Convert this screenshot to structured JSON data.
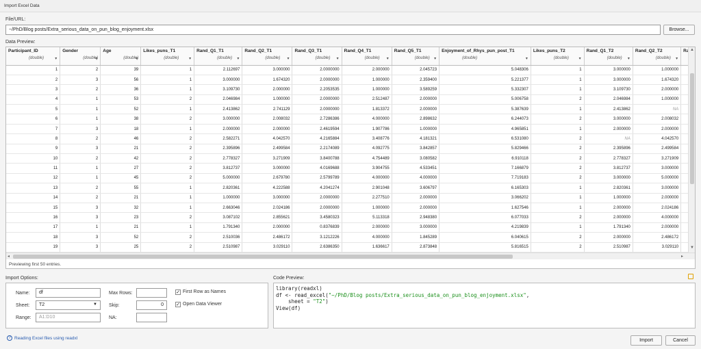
{
  "window": {
    "title": "Import Excel Data"
  },
  "file": {
    "label": "File/URL:",
    "value": "~/PhD/Blog posts/Extra_serious_data_on_pun_blog_enjoyment.xlsx",
    "browse_label": "Browse..."
  },
  "preview": {
    "label": "Data Preview:",
    "footer": "Previewing first 50 entries.",
    "columns": [
      {
        "name": "Participant_ID",
        "type": "(double)"
      },
      {
        "name": "Gender",
        "type": "(double)"
      },
      {
        "name": "Age",
        "type": "(double)"
      },
      {
        "name": "Likes_puns_T1",
        "type": "(double)"
      },
      {
        "name": "Rand_Q1_T1",
        "type": "(double)"
      },
      {
        "name": "Rand_Q2_T1",
        "type": "(double)"
      },
      {
        "name": "Rand_Q3_T1",
        "type": "(double)"
      },
      {
        "name": "Rand_Q4_T1",
        "type": "(double)"
      },
      {
        "name": "Rand_Q5_T1",
        "type": "(double)"
      },
      {
        "name": "Enjoyment_of_Rhys_pun_post_T1",
        "type": "(double)"
      },
      {
        "name": "Likes_puns_T2",
        "type": "(double)"
      },
      {
        "name": "Rand_Q1_T2",
        "type": "(double)"
      },
      {
        "name": "Rand_Q2_T2",
        "type": "(double)"
      },
      {
        "name": "Ra",
        "type": ""
      }
    ],
    "rows": [
      [
        "1",
        "2",
        "39",
        "1",
        "2.112697",
        "3.000000",
        "2.0000000",
        "2.000000",
        "2.045723",
        "5.048306",
        "1",
        "3.000000",
        "1.000000"
      ],
      [
        "2",
        "3",
        "56",
        "1",
        "3.000000",
        "1.674320",
        "2.0000000",
        "1.000000",
        "2.359400",
        "5.221377",
        "1",
        "3.000000",
        "1.674320"
      ],
      [
        "3",
        "2",
        "36",
        "1",
        "3.109730",
        "2.000000",
        "2.2053535",
        "1.000000",
        "3.589259",
        "5.332307",
        "1",
        "3.109730",
        "2.000000"
      ],
      [
        "4",
        "1",
        "53",
        "2",
        "2.046984",
        "1.000000",
        "2.0000000",
        "2.512487",
        "2.000000",
        "5.006758",
        "2",
        "2.046984",
        "1.000000"
      ],
      [
        "5",
        "1",
        "52",
        "1",
        "2.413862",
        "2.741129",
        "2.0000000",
        "1.813372",
        "2.000000",
        "5.387639",
        "1",
        "2.413862",
        "NA"
      ],
      [
        "6",
        "1",
        "38",
        "2",
        "3.000000",
        "2.008032",
        "2.7286386",
        "4.000000",
        "2.898632",
        "6.244073",
        "2",
        "3.000000",
        "2.008032"
      ],
      [
        "7",
        "3",
        "18",
        "1",
        "2.000000",
        "2.000000",
        "2.4619594",
        "1.907786",
        "1.000000",
        "4.965851",
        "1",
        "2.000000",
        "2.000000"
      ],
      [
        "8",
        "2",
        "46",
        "2",
        "2.582271",
        "4.042570",
        "4.2165884",
        "3.408776",
        "4.181321",
        "6.531080",
        "2",
        "NA",
        "4.042570"
      ],
      [
        "9",
        "3",
        "21",
        "2",
        "2.395896",
        "2.499584",
        "2.2174089",
        "4.092775",
        "3.842857",
        "5.829466",
        "2",
        "2.395896",
        "2.499584"
      ],
      [
        "10",
        "2",
        "42",
        "2",
        "2.778327",
        "3.271909",
        "3.8400788",
        "4.754489",
        "3.080582",
        "6.910118",
        "2",
        "2.778327",
        "3.271909"
      ],
      [
        "11",
        "1",
        "27",
        "2",
        "3.812737",
        "3.000000",
        "4.0169688",
        "3.904755",
        "4.533451",
        "7.166879",
        "2",
        "3.812737",
        "3.000000"
      ],
      [
        "12",
        "1",
        "45",
        "2",
        "5.000000",
        "2.679780",
        "2.5799789",
        "4.000000",
        "4.000000",
        "7.719183",
        "2",
        "3.000000",
        "5.000000"
      ],
      [
        "13",
        "2",
        "55",
        "1",
        "2.820361",
        "4.222588",
        "4.2041274",
        "2.901048",
        "3.606797",
        "6.165303",
        "1",
        "2.820361",
        "3.000000"
      ],
      [
        "14",
        "2",
        "21",
        "1",
        "1.000000",
        "3.000000",
        "2.0000000",
        "2.277510",
        "2.000000",
        "3.066202",
        "1",
        "1.000000",
        "2.000000"
      ],
      [
        "15",
        "3",
        "32",
        "1",
        "2.663046",
        "2.024186",
        "2.0000000",
        "1.000000",
        "2.000000",
        "1.627546",
        "1",
        "2.000000",
        "2.024186"
      ],
      [
        "16",
        "3",
        "23",
        "2",
        "3.087102",
        "2.855621",
        "3.4580323",
        "5.113318",
        "2.948380",
        "6.077033",
        "2",
        "2.000000",
        "4.000000"
      ],
      [
        "17",
        "1",
        "21",
        "1",
        "1.791340",
        "2.000000",
        "0.8376839",
        "2.000000",
        "3.000000",
        "4.219839",
        "1",
        "1.791340",
        "2.000000"
      ],
      [
        "18",
        "3",
        "52",
        "2",
        "2.510036",
        "2.486172",
        "3.1212226",
        "4.000000",
        "1.845289",
        "6.040615",
        "2",
        "2.000000",
        "2.486172"
      ],
      [
        "19",
        "3",
        "25",
        "2",
        "2.510987",
        "3.029110",
        "2.6386350",
        "1.636617",
        "2.873848",
        "5.816515",
        "2",
        "2.510987",
        "3.029110"
      ]
    ]
  },
  "import_options": {
    "label": "Import Options:",
    "name_label": "Name:",
    "name_value": "df",
    "sheet_label": "Sheet:",
    "sheet_value": "T2",
    "range_label": "Range:",
    "range_placeholder": "A1:D10",
    "maxrows_label": "Max Rows:",
    "maxrows_value": "",
    "skip_label": "Skip:",
    "skip_value": "0",
    "na_label": "NA:",
    "na_value": "",
    "first_row_label": "First Row as Names",
    "open_viewer_label": "Open Data Viewer",
    "first_row_checked": "✓",
    "open_viewer_checked": "✓"
  },
  "code_preview": {
    "label": "Code Preview:",
    "line1_fn": "library",
    "line1_rest": "(readxl)",
    "line2_pre": "df <- read_excel(",
    "line2_str": "\"~/PhD/Blog posts/Extra_serious_data_on_pun_blog_enjoyment.xlsx\"",
    "line2_post": ",",
    "line3_pre": "    sheet = ",
    "line3_str": "\"T2\"",
    "line3_post": ")",
    "line4": "View(df)"
  },
  "help_link": "Reading Excel files using readxl",
  "buttons": {
    "import": "Import",
    "cancel": "Cancel"
  },
  "colors": {
    "link": "#2a5db0",
    "string": "#1a8f1a",
    "copy_icon": "#e0a000"
  }
}
